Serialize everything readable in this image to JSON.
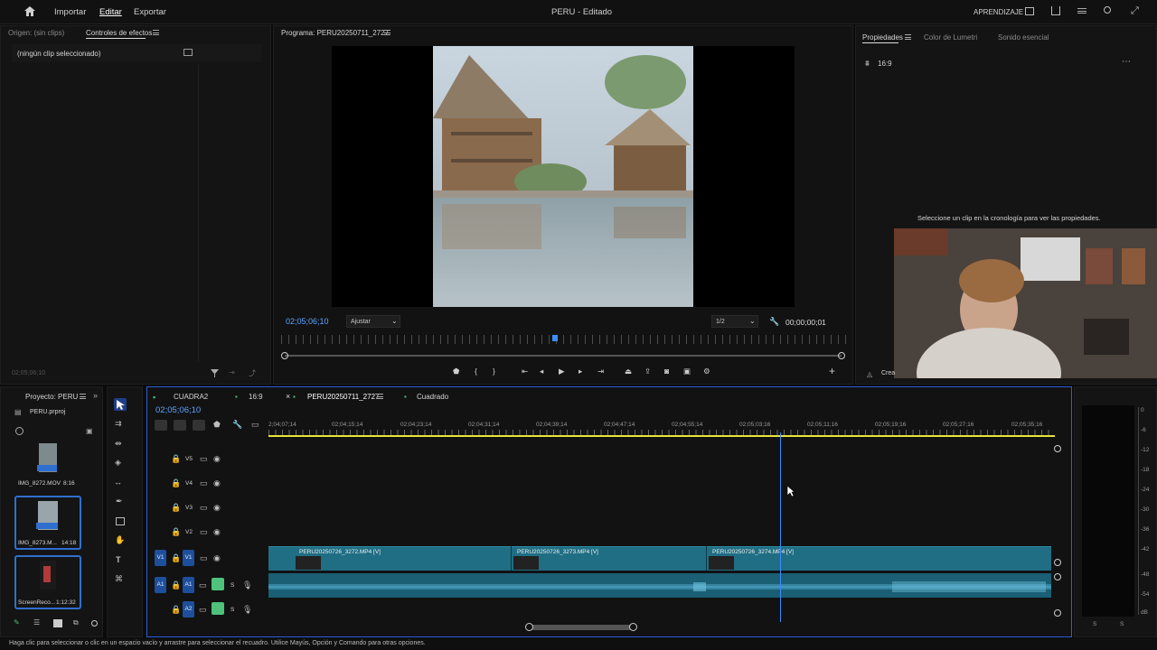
{
  "topbar": {
    "menu": [
      "Importar",
      "Editar",
      "Exportar"
    ],
    "title": "PERU - Editado",
    "learn": "APRENDIZAJE"
  },
  "source_panel": {
    "tab_origin": "Origen: (sin clips)",
    "tab_effects": "Controles de efectos",
    "no_clip": "(ningún clip seleccionado)",
    "timecode": "02;05;06;10"
  },
  "program": {
    "title": "Programa: PERU20250711_2727",
    "timecode": "02;05;06;10",
    "fit": "Ajustar",
    "resolution": "1/2",
    "duration": "00;00;00;01"
  },
  "properties": {
    "tabs": [
      "Propiedades",
      "Color de Lumetri",
      "Sonido esencial"
    ],
    "seq": "16:9",
    "hint": "Seleccione un clip en la cronología para ver las propiedades.",
    "create": "Crea"
  },
  "project": {
    "tab": "Proyecto: PERU",
    "file": "PERU.prproj",
    "items": [
      {
        "name": "IMG_8272.MOV",
        "dur": "8:16"
      },
      {
        "name": "IMG_8273.M...",
        "dur": "14:18"
      },
      {
        "name": "ScreenReco...",
        "dur": "1:12:32"
      }
    ]
  },
  "timeline": {
    "tabs": [
      "CUADRA2",
      "16:9",
      "PERU20250711_2727",
      "Cuadrado"
    ],
    "timecode": "02;05;06;10",
    "ruler": [
      "2;04;07;14",
      "02;04;15;14",
      "02;04;23;14",
      "02;04;31;14",
      "02;04;39;14",
      "02;04;47;14",
      "02;04;55;14",
      "02;05;03;16",
      "02;05;11;16",
      "02;05;19;16",
      "02;05;27;16",
      "02;05;35;16"
    ],
    "tracks_video": [
      "V5",
      "V4",
      "V3",
      "V2",
      "V1"
    ],
    "tracks_audio": [
      "A1",
      "A2"
    ],
    "source_v": "V1",
    "source_a": "A1",
    "clips": [
      "PERU20250726_3272.MP4 [V]",
      "PERU20250726_3273.MP4 [V]",
      "PERU20250726_3274.MP4 [V]"
    ],
    "solo": "S"
  },
  "meter": {
    "scale": [
      "0",
      "-6",
      "-12",
      "-18",
      "-24",
      "-30",
      "-36",
      "-42",
      "-48",
      "-54",
      "dB"
    ],
    "s": "S"
  },
  "status": "Haga clic para seleccionar o clic en un espacio vacío y arrastre para seleccionar el recuadro. Utilice Mayús, Opción y Comando para otras opciones."
}
